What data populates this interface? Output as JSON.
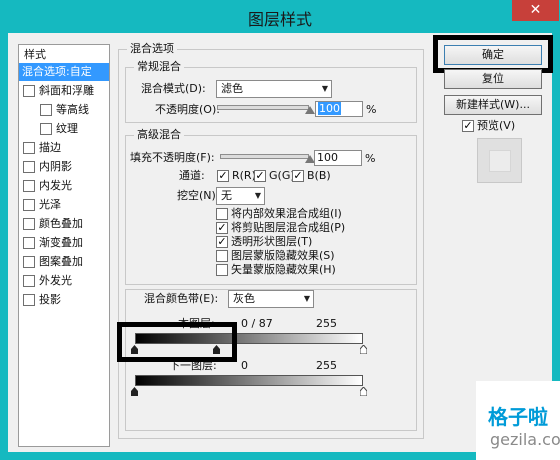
{
  "window": {
    "title": "图层样式",
    "close_glyph": "✕"
  },
  "sidebar": {
    "header": "样式",
    "items": [
      {
        "label": "混合选项:自定",
        "checkbox": false,
        "checked": false,
        "selected": true
      },
      {
        "label": "斜面和浮雕",
        "checkbox": true,
        "checked": false,
        "selected": false
      },
      {
        "label": "等高线",
        "checkbox": true,
        "checked": false,
        "selected": false
      },
      {
        "label": "纹理",
        "checkbox": true,
        "checked": false,
        "selected": false
      },
      {
        "label": "描边",
        "checkbox": true,
        "checked": false,
        "selected": false
      },
      {
        "label": "内阴影",
        "checkbox": true,
        "checked": false,
        "selected": false
      },
      {
        "label": "内发光",
        "checkbox": true,
        "checked": false,
        "selected": false
      },
      {
        "label": "光泽",
        "checkbox": true,
        "checked": false,
        "selected": false
      },
      {
        "label": "颜色叠加",
        "checkbox": true,
        "checked": false,
        "selected": false
      },
      {
        "label": "渐变叠加",
        "checkbox": true,
        "checked": false,
        "selected": false
      },
      {
        "label": "图案叠加",
        "checkbox": true,
        "checked": false,
        "selected": false
      },
      {
        "label": "外发光",
        "checkbox": true,
        "checked": false,
        "selected": false
      },
      {
        "label": "投影",
        "checkbox": true,
        "checked": false,
        "selected": false
      }
    ]
  },
  "blend_options": {
    "title": "混合选项",
    "general": {
      "title": "常规混合",
      "mode_label": "混合模式(D):",
      "mode_value": "滤色",
      "opacity_label": "不透明度(O):",
      "opacity_value": "100",
      "percent": "%"
    },
    "advanced": {
      "title": "高级混合",
      "fill_label": "填充不透明度(F):",
      "fill_value": "100",
      "percent": "%",
      "channels_label": "通道:",
      "channels": [
        {
          "label": "R(R)",
          "checked": true
        },
        {
          "label": "G(G)",
          "checked": true
        },
        {
          "label": "B(B)",
          "checked": true
        }
      ],
      "knockout_label": "挖空(N):",
      "knockout_value": "无",
      "options": [
        {
          "label": "将内部效果混合成组(I)",
          "checked": false
        },
        {
          "label": "将剪贴图层混合成组(P)",
          "checked": true
        },
        {
          "label": "透明形状图层(T)",
          "checked": true
        },
        {
          "label": "图层蒙版隐藏效果(S)",
          "checked": false
        },
        {
          "label": "矢量蒙版隐藏效果(H)",
          "checked": false
        }
      ]
    },
    "blend_if": {
      "label": "混合颜色带(E):",
      "value": "灰色",
      "this_layer": {
        "label": "本图层:",
        "values": "0  /  87",
        "max": "255"
      },
      "underlying": {
        "label": "下一图层:",
        "min": "0",
        "max": "255"
      }
    }
  },
  "buttons": {
    "ok": "确定",
    "reset": "复位",
    "new_style": "新建样式(W)...",
    "preview_label": "预览(V)",
    "preview_checked": true
  },
  "watermark": {
    "top": "格子啦",
    "bottom": "gezila.com"
  }
}
